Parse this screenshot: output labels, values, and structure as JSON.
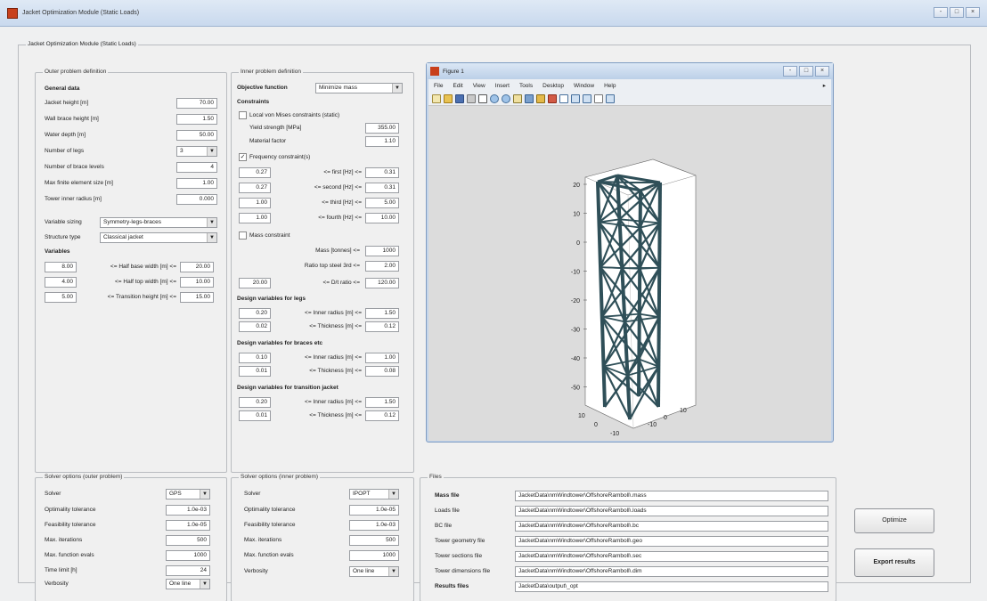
{
  "window": {
    "title": "Jacket Optimization Module (Static Loads)",
    "buttons": [
      "-",
      "□",
      "×"
    ]
  },
  "mainframe_title": "Jacket Optimization Module (Static Loads)",
  "outer": {
    "title": "Outer problem definition",
    "general_heading": "General data",
    "rows": [
      {
        "label": "Jacket height [m]",
        "value": "70.00"
      },
      {
        "label": "Wall brace height [m]",
        "value": "1.50"
      },
      {
        "label": "Water depth [m]",
        "value": "50.00"
      },
      {
        "label": "Number of legs",
        "value": "3"
      },
      {
        "label": "Number of brace levels",
        "value": "4"
      },
      {
        "label": "Max finite element size [m]",
        "value": "1.00"
      },
      {
        "label": "Tower inner radius [m]",
        "value": "0.000"
      }
    ],
    "variable_sizing_label": "Variable sizing",
    "variable_sizing_value": "Symmetry-legs-braces",
    "structure_type_label": "Structure type",
    "structure_type_value": "Classical jacket",
    "variables_heading": "Variables",
    "variables": [
      {
        "lo": "8.00",
        "label": "<= Half base width [m] <=",
        "hi": "20.00"
      },
      {
        "lo": "4.00",
        "label": "<= Half top width [m] <=",
        "hi": "10.00"
      },
      {
        "lo": "5.00",
        "label": "<= Transition height [m] <=",
        "hi": "15.00"
      }
    ]
  },
  "inner": {
    "title": "Inner problem definition",
    "objective_label": "Objective function",
    "objective_value": "Minimize mass",
    "constraints_heading": "Constraints",
    "local_stress_label": "Local von Mises constraints (static)",
    "yield_label": "Yield strength [MPa]",
    "yield_value": "355.00",
    "safety_label": "Material factor",
    "safety_value": "1.10",
    "freq_label": "Frequency constraint(s)",
    "freq_rows": [
      {
        "lo": "0.27",
        "label": "<= first [Hz] <=",
        "hi": "0.31"
      },
      {
        "lo": "0.27",
        "label": "<= second [Hz] <=",
        "hi": "0.31"
      },
      {
        "lo": "1.00",
        "label": "<= third [Hz] <=",
        "hi": "5.00"
      },
      {
        "lo": "1.00",
        "label": "<= fourth [Hz] <=",
        "hi": "10.00"
      }
    ],
    "mass_label": "Mass constraint",
    "mass_rows": [
      {
        "label": "Mass [tonnes] <=",
        "value": "1000"
      },
      {
        "label": "Ratio top steel 3rd <=",
        "value": "2.00"
      }
    ],
    "dratio_lo": "20.00",
    "dratio_label": "<= D/t ratio <=",
    "dratio_hi": "120.00",
    "legs_heading": "Design variables for legs",
    "legs_rows": [
      {
        "lo": "0.20",
        "label": "<= Inner radius [m] <=",
        "hi": "1.50"
      },
      {
        "lo": "0.02",
        "label": "<= Thickness [m] <=",
        "hi": "0.12"
      }
    ],
    "braces_heading": "Design variables for braces etc",
    "braces_rows": [
      {
        "lo": "0.10",
        "label": "<= Inner radius [m] <=",
        "hi": "1.00"
      },
      {
        "lo": "0.01",
        "label": "<= Thickness [m] <=",
        "hi": "0.08"
      }
    ],
    "trans_heading": "Design variables for transition jacket",
    "trans_rows": [
      {
        "lo": "0.20",
        "label": "<= Inner radius [m] <=",
        "hi": "1.50"
      },
      {
        "lo": "0.01",
        "label": "<= Thickness [m] <=",
        "hi": "0.12"
      }
    ]
  },
  "figure": {
    "title": "Figure 1",
    "menu": [
      "File",
      "Edit",
      "View",
      "Insert",
      "Tools",
      "Desktop",
      "Window",
      "Help"
    ],
    "win_buttons": [
      "-",
      "□",
      "×"
    ],
    "menu_arrow": "▸",
    "z_ticks": [
      "20",
      "10",
      "0",
      "-10",
      "-20",
      "-30",
      "-40",
      "-50"
    ],
    "x_ticks": [
      "10",
      "0",
      "-10"
    ],
    "y_ticks": [
      "-10",
      "0",
      "10"
    ],
    "colors": {
      "jacket": "#2f4f58",
      "axes_bg": "#ffffff",
      "canvas": "#dcdcdc"
    }
  },
  "solver_outer": {
    "title": "Solver options (outer problem)",
    "solver_label": "Solver",
    "solver_value": "GPS",
    "rows": [
      {
        "label": "Optimality tolerance",
        "value": "1.0e-03"
      },
      {
        "label": "Feasibility tolerance",
        "value": "1.0e-05"
      },
      {
        "label": "Max. iterations",
        "value": "500"
      },
      {
        "label": "Max. function evals",
        "value": "1000"
      },
      {
        "label": "Time limit [h]",
        "value": "24"
      }
    ],
    "verbosity_label": "Verbosity",
    "verbosity_value": "One line"
  },
  "solver_inner": {
    "title": "Solver options (inner problem)",
    "solver_label": "Solver",
    "solver_value": "IPOPT",
    "rows": [
      {
        "label": "Optimality tolerance",
        "value": "1.0e-05"
      },
      {
        "label": "Feasibility tolerance",
        "value": "1.0e-03"
      },
      {
        "label": "Max. iterations",
        "value": "500"
      },
      {
        "label": "Max. function evals",
        "value": "1000"
      }
    ],
    "verbosity_label": "Verbosity",
    "verbosity_value": "One line"
  },
  "files": {
    "title": "Files",
    "rows": [
      {
        "label": "Mass file",
        "value": "JacketData\\nmWindtower\\OffshoreRamboll\\.mass"
      },
      {
        "label": "Loads file",
        "value": "JacketData\\nmWindtower\\OffshoreRamboll\\.loads"
      },
      {
        "label": "BC file",
        "value": "JacketData\\nmWindtower\\OffshoreRamboll\\.bc"
      },
      {
        "label": "Tower geometry file",
        "value": "JacketData\\nmWindtower\\OffshoreRamboll\\.geo"
      },
      {
        "label": "Tower sections file",
        "value": "JacketData\\nmWindtower\\OffshoreRamboll\\.sec"
      },
      {
        "label": "Tower dimensions file",
        "value": "JacketData\\nmWindtower\\OffshoreRamboll\\.dim"
      },
      {
        "label": "Results files",
        "value": "JacketData\\output\\_opt"
      }
    ]
  },
  "actions": {
    "optimize": "Optimize",
    "export": "Export results"
  }
}
